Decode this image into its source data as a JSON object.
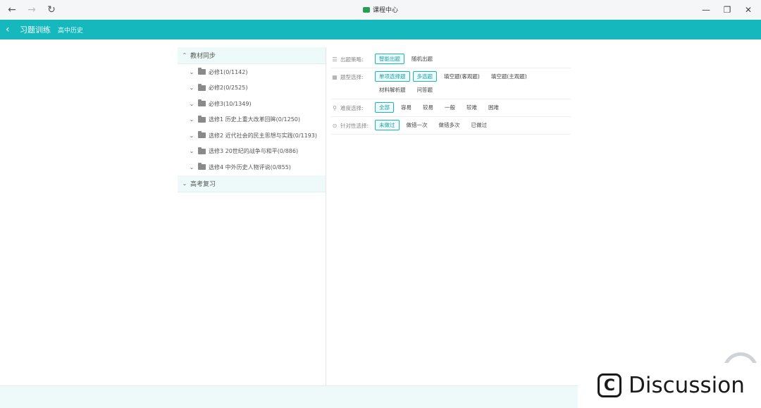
{
  "titlebar": {
    "back_icon": "←",
    "forward_icon": "→",
    "refresh_icon": "↻",
    "title": "课程中心",
    "minimize_icon": "—",
    "restore_icon": "❐",
    "close_icon": "✕"
  },
  "header": {
    "back_icon": "‹",
    "title": "习题训练",
    "subtitle": "高中历史",
    "color": "#14b8bd"
  },
  "tree": {
    "section1": {
      "label": "教材同步",
      "chevron": "^"
    },
    "items": [
      {
        "label": "必修1(0/1142)"
      },
      {
        "label": "必修2(0/2525)"
      },
      {
        "label": "必修3(10/1349)"
      },
      {
        "label": "选修1 历史上重大改革回眸(0/1250)"
      },
      {
        "label": "选修2 近代社会的民主思想与实践(0/1193)"
      },
      {
        "label": "选修3 20世纪的战争与和平(0/886)"
      },
      {
        "label": "选修4 中外历史人物评说(0/855)"
      }
    ],
    "item_chevron": "⌄",
    "section2": {
      "label": "高考复习",
      "chevron": "⌄"
    }
  },
  "filters": {
    "strategy": {
      "icon": "☰",
      "label": "出题策略:",
      "options": [
        "智能出题",
        "随机出题"
      ]
    },
    "type": {
      "icon": "▦",
      "label": "题型选择:",
      "options": [
        "单项选择题",
        "多选题",
        "填空题(客观题)",
        "填空题(主观题)",
        "材料解析题",
        "问答题"
      ]
    },
    "difficulty": {
      "icon": "⚲",
      "label": "难度选择:",
      "options": [
        "全部",
        "容易",
        "较易",
        "一般",
        "较难",
        "困难"
      ]
    },
    "targeted": {
      "icon": "⊙",
      "label": "针对性选择:",
      "options": [
        "未做过",
        "做错一次",
        "做错多次",
        "已做过"
      ]
    }
  },
  "watermark": {
    "logo": "C",
    "text": "Discussion"
  }
}
